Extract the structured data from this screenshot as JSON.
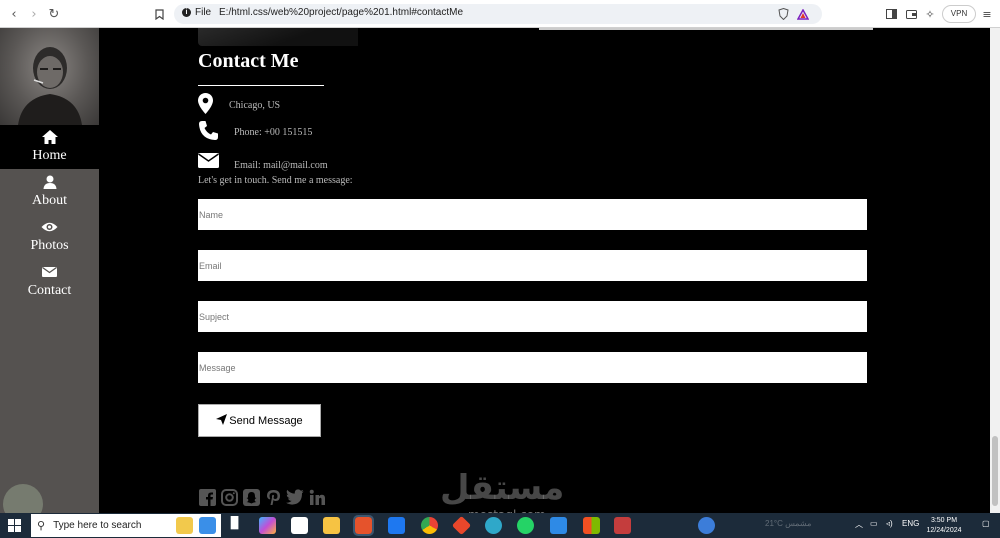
{
  "browser": {
    "url_scheme": "File",
    "url": "E:/html.css/web%20project/page%201.html#contactMe",
    "vpn_label": "VPN"
  },
  "sidebar": {
    "items": [
      {
        "label": "Home",
        "icon": "home-icon",
        "active": true
      },
      {
        "label": "About",
        "icon": "user-icon",
        "active": false
      },
      {
        "label": "Photos",
        "icon": "eye-icon",
        "active": false
      },
      {
        "label": "Contact",
        "icon": "envelope-icon",
        "active": false
      }
    ]
  },
  "contact": {
    "title": "Contact Me",
    "location": "Chicago, US",
    "phone": "Phone: +00 151515",
    "email": "Email: mail@mail.com",
    "invite": "Let's get in touch. Send me a message:"
  },
  "form": {
    "name_placeholder": "Name",
    "email_placeholder": "Email",
    "subject_placeholder": "Supject",
    "message_placeholder": "Message",
    "send_label": "Send Message"
  },
  "social": [
    "facebook-icon",
    "instagram-icon",
    "snapchat-icon",
    "pinterest-icon",
    "twitter-icon",
    "linkedin-icon"
  ],
  "watermark": {
    "text": "مستقل",
    "sub": "mostaql.com"
  },
  "taskbar": {
    "search_placeholder": "Type here to search",
    "weather": "21°C مشمس",
    "language": "ENG",
    "time": "3:50 PM",
    "date": "12/24/2024"
  }
}
